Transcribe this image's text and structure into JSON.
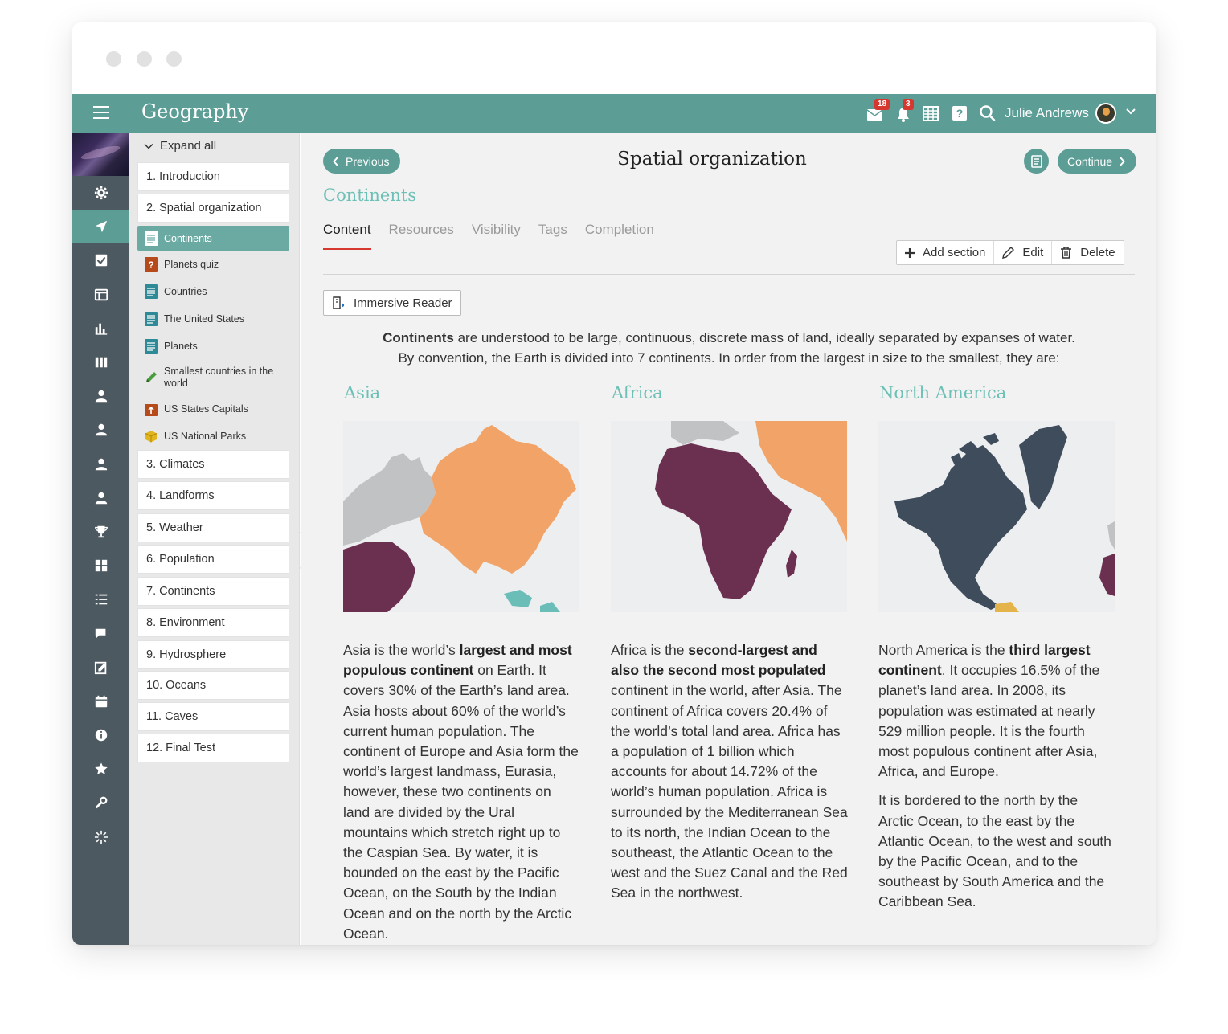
{
  "app": {
    "title": "Geography"
  },
  "header": {
    "mail_badge": "18",
    "notif_badge": "3",
    "user_name": "Julie Andrews"
  },
  "sidebar": {
    "expand_all": "Expand all",
    "chapters": [
      "1. Introduction",
      "2. Spatial organization",
      "3. Climates",
      "4. Landforms",
      "5. Weather",
      "6. Population",
      "7. Continents",
      "8. Environment",
      "9. Hydrosphere",
      "10. Oceans",
      "11. Caves",
      "12. Final Test"
    ],
    "sub_items": [
      {
        "label": "Continents",
        "icon": "document-icon",
        "active": true
      },
      {
        "label": "Planets quiz",
        "icon": "quiz-icon"
      },
      {
        "label": "Countries",
        "icon": "document-icon"
      },
      {
        "label": "The United States",
        "icon": "document-icon"
      },
      {
        "label": "Planets",
        "icon": "document-icon"
      },
      {
        "label": "Smallest countries in the world",
        "icon": "pencil-icon"
      },
      {
        "label": "US States Capitals",
        "icon": "upload-box-icon"
      },
      {
        "label": "US National Parks",
        "icon": "package-icon"
      }
    ]
  },
  "main": {
    "previous": "Previous",
    "page_title": "Spatial organization",
    "continue": "Continue",
    "section_title": "Continents",
    "tabs": [
      "Content",
      "Resources",
      "Visibility",
      "Tags",
      "Completion"
    ],
    "actions": {
      "add_section": "Add section",
      "edit": "Edit",
      "delete": "Delete"
    },
    "immersive_reader": "Immersive Reader",
    "intro_bold": "Continents",
    "intro_rest": " are understood to be large, continuous, discrete mass of land, ideally separated by expanses of water.",
    "intro_line2": "By convention, the Earth is divided into 7 continents. In order from the largest in size to the smallest, they are:",
    "columns": [
      {
        "title": "Asia",
        "p1_a": "Asia is the world’s ",
        "p1_b": "largest and most populous continent",
        "p1_c": " on Earth. It covers 30% of the Earth’s land area. Asia hosts about 60% of the world’s current human population. The continent of Europe and Asia form the world’s largest landmass, Eurasia, however, these two continents on land are divided by the Ural mountains which stretch right up to the Caspian Sea. By water, it is bounded on the east by the Pacific Ocean, on the South by the Indian Ocean and on the north by the Arctic Ocean."
      },
      {
        "title": "Africa",
        "p1_a": "Africa is the ",
        "p1_b": "second-largest and also the second most populated",
        "p1_c": " continent in the world, after Asia. The continent of Africa covers 20.4% of the world’s total land area. Africa has a population of 1 billion which accounts for about 14.72% of the world’s human population. Africa is surrounded by the Mediterranean Sea to its north, the Indian Ocean to the southeast, the Atlantic Ocean to the west and the Suez Canal and the Red Sea in the northwest."
      },
      {
        "title": "North America",
        "p1_a": "North America is the ",
        "p1_b": "third largest continent",
        "p1_c": ". It occupies 16.5% of the planet’s land area. In 2008, its population was estimated at nearly 529 million people. It is the fourth most populous continent after Asia, Africa, and Europe.",
        "p2": "It is bordered to the north by the Arctic Ocean, to the east by the Atlantic Ocean, to the west and south by the Pacific Ocean, and to the southeast by South America and the Caribbean Sea."
      }
    ]
  },
  "colors": {
    "brand": "#5c9e96",
    "accent_title": "#6dc0b6",
    "rail": "#4d5960",
    "badge": "#d6372e"
  }
}
